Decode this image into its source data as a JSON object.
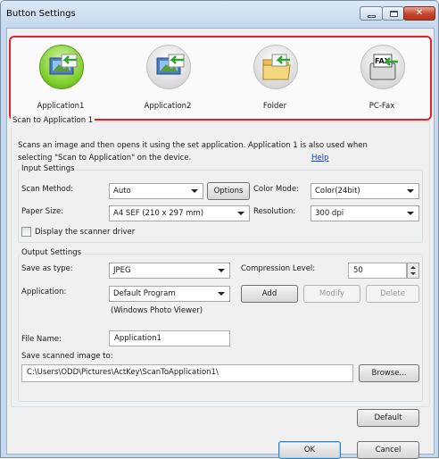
{
  "window": {
    "title": "Button Settings",
    "close_glyph": "✕"
  },
  "app_buttons": [
    {
      "label": "Application1",
      "icon": "scan-to-application-icon",
      "selected": true
    },
    {
      "label": "Application2",
      "icon": "scan-to-application-icon",
      "selected": false
    },
    {
      "label": "Folder",
      "icon": "scan-to-folder-icon",
      "selected": false
    },
    {
      "label": "PC-Fax",
      "icon": "scan-to-pcfax-icon",
      "selected": false
    }
  ],
  "scan_group": {
    "label": "Scan to Application 1",
    "description_line1": "Scans an image and then opens it using the set application. Application 1 is also used when",
    "description_line2": "selecting \"Scan to Application\" on the device.",
    "help_link": "Help"
  },
  "input_settings": {
    "label": "Input Settings",
    "scan_method_label": "Scan Method:",
    "scan_method_value": "Auto",
    "options_button": "Options",
    "color_mode_label": "Color Mode:",
    "color_mode_value": "Color(24bit)",
    "paper_size_label": "Paper Size:",
    "paper_size_value": "A4 SEF (210 x 297 mm)",
    "resolution_label": "Resolution:",
    "resolution_value": "300 dpi",
    "display_driver_label": "Display the scanner driver",
    "display_driver_checked": false
  },
  "output_settings": {
    "label": "Output Settings",
    "save_as_type_label": "Save as type:",
    "save_as_type_value": "JPEG",
    "compression_label": "Compression Level:",
    "compression_value": "50",
    "application_label": "Application:",
    "application_value": "Default Program",
    "add_button": "Add",
    "modify_button": "Modify",
    "delete_button": "Delete",
    "application_note": "(Windows Photo Viewer)",
    "file_name_label": "File Name:",
    "file_name_value": "Application1",
    "save_path_label": "Save scanned image to:",
    "save_path_value": "C:\\Users\\ODD\\Pictures\\ActKey\\ScanToApplication1\\",
    "browse_button": "Browse..."
  },
  "footer": {
    "default_button": "Default",
    "ok_button": "OK",
    "cancel_button": "Cancel"
  },
  "colors": {
    "selected_app_bg": "#7fcf2c",
    "highlight_border": "#e0242f",
    "close_button": "#c7432c",
    "link": "#0a3ecf"
  }
}
